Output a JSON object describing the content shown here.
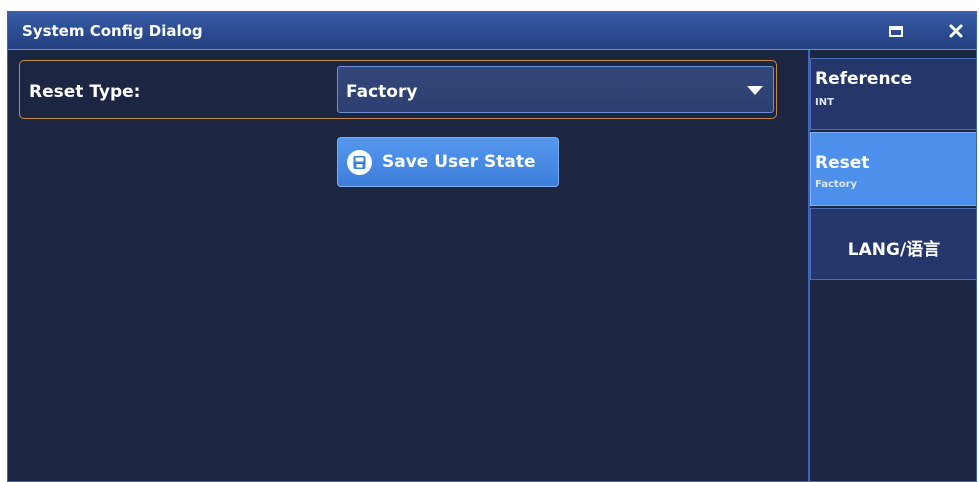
{
  "window": {
    "title": "System Config Dialog"
  },
  "reset": {
    "label": "Reset Type:",
    "value": "Factory"
  },
  "actions": {
    "save_label": "Save User State"
  },
  "sidebar": {
    "items": [
      {
        "title": "Reference",
        "subtitle": "INT"
      },
      {
        "title": "Reset",
        "subtitle": "Factory",
        "selected": true
      },
      {
        "title": "LANG/语言",
        "subtitle": ""
      }
    ]
  },
  "icons": {
    "maximize": "maximize-icon",
    "close": "close-icon",
    "save": "save-icon",
    "dropdown": "chevron-down-icon"
  },
  "colors": {
    "titlebar": "#2c4c92",
    "background": "#1c2642",
    "accent": "#4d90ec",
    "field_border": "#c88a3a"
  }
}
